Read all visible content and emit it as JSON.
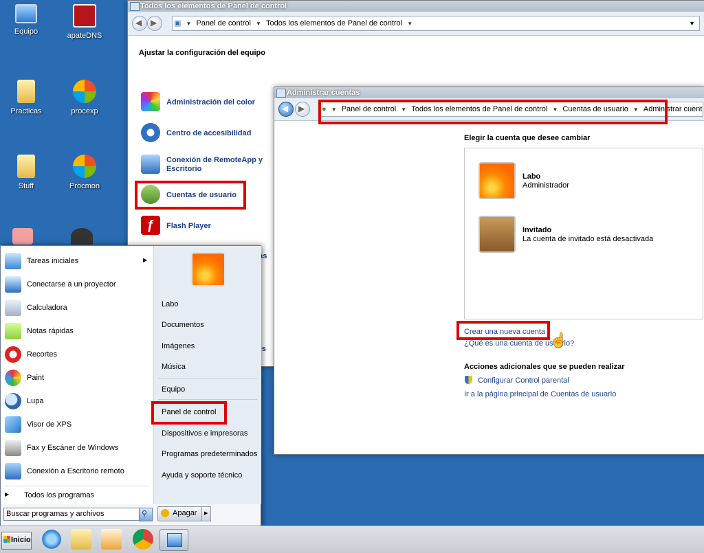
{
  "desktop": {
    "icons": [
      {
        "label": "Equipo",
        "icon": "computer-icon"
      },
      {
        "label": "apateDNS",
        "icon": "app-icon"
      },
      {
        "label": "Practicas",
        "icon": "folder-icon"
      },
      {
        "label": "procexp",
        "icon": "procexp-icon"
      },
      {
        "label": "Stuff",
        "icon": "folder-icon"
      },
      {
        "label": "Procmon",
        "icon": "procmon-icon"
      }
    ]
  },
  "control_panel": {
    "title": "Todos los elementos de Panel de control",
    "breadcrumb": [
      "Panel de control",
      "Todos los elementos de Panel de control"
    ],
    "heading": "Ajustar la configuración del equipo",
    "items": [
      {
        "label": "Administración del color",
        "icon": "color-management-icon"
      },
      {
        "label": "Centro de accesibilidad",
        "icon": "accessibility-icon"
      },
      {
        "label": "Conexión de RemoteApp y Escritorio",
        "icon": "remoteapp-icon"
      },
      {
        "label": "Cuentas de usuario",
        "icon": "user-accounts-icon"
      },
      {
        "label": "Flash Player",
        "icon": "flash-icon"
      }
    ],
    "partial_text_1": "vas",
    "partial_text_2": "os"
  },
  "accounts_window": {
    "title": "Administrar cuentas",
    "breadcrumb": [
      "Panel de control",
      "Todos los elementos de Panel de control",
      "Cuentas de usuario",
      "Administrar cuentas"
    ],
    "heading": "Elegir la cuenta que desee cambiar",
    "accounts": [
      {
        "name": "Labo",
        "role": "Administrador",
        "icon": "flower-avatar-icon"
      },
      {
        "name": "Invitado",
        "role": "La cuenta de invitado está desactivada",
        "icon": "briefcase-avatar-icon"
      }
    ],
    "create_link": "Crear una nueva cuenta",
    "what_link": "¿Qué es una cuenta de usuario?",
    "actions_heading": "Acciones adicionales que se pueden realizar",
    "parental_link": "Configurar Control parental",
    "main_page_link": "Ir a la página principal de Cuentas de usuario"
  },
  "start_menu": {
    "left_items": [
      {
        "label": "Tareas iniciales",
        "icon": "getting-started-icon",
        "has_arrow": true
      },
      {
        "label": "Conectarse a un proyector",
        "icon": "projector-icon"
      },
      {
        "label": "Calculadora",
        "icon": "calculator-icon"
      },
      {
        "label": "Notas rápidas",
        "icon": "sticky-notes-icon"
      },
      {
        "label": "Recortes",
        "icon": "snipping-icon"
      },
      {
        "label": "Paint",
        "icon": "paint-icon"
      },
      {
        "label": "Lupa",
        "icon": "magnifier-icon"
      },
      {
        "label": "Visor de XPS",
        "icon": "xps-icon"
      },
      {
        "label": "Fax y Escáner de Windows",
        "icon": "fax-icon"
      },
      {
        "label": "Conexión a Escritorio remoto",
        "icon": "remote-desktop-icon"
      }
    ],
    "all_programs": "Todos los programas",
    "search_placeholder": "Buscar programas y archivos",
    "right_items": [
      "Labo",
      "Documentos",
      "Imágenes",
      "Música",
      "Equipo",
      "Panel de control",
      "Dispositivos e impresoras",
      "Programas predeterminados",
      "Ayuda y soporte técnico"
    ],
    "shutdown_label": "Apagar"
  },
  "taskbar": {
    "start_label": "Inicio",
    "buttons": [
      "ie-icon",
      "explorer-icon",
      "media-player-icon",
      "chrome-icon",
      "control-panel-icon"
    ]
  }
}
